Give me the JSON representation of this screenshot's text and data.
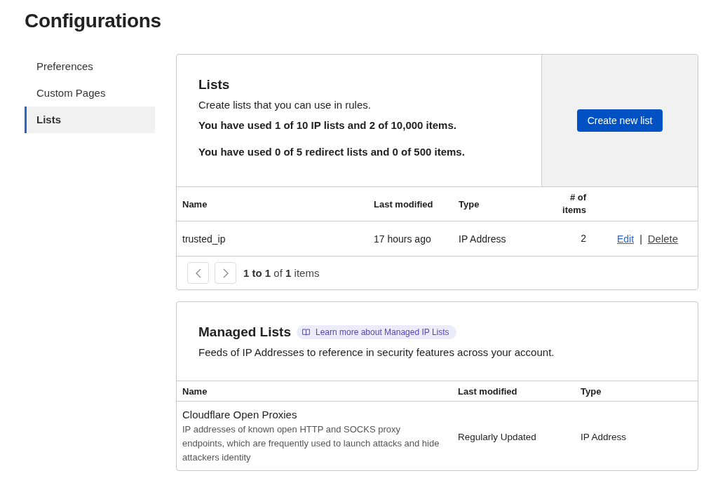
{
  "page": {
    "title": "Configurations"
  },
  "sidebar": {
    "items": [
      {
        "label": "Preferences",
        "selected": false
      },
      {
        "label": "Custom Pages",
        "selected": false
      },
      {
        "label": "Lists",
        "selected": true
      }
    ]
  },
  "lists": {
    "title": "Lists",
    "description": "Create lists that you can use in rules.",
    "usage": [
      "You have used 1 of 10 IP lists and 2 of 10,000 items.",
      "You have used 0 of 5 redirect lists and 0 of 500 items."
    ],
    "create_button": "Create new list",
    "table": {
      "columns": [
        "Name",
        "Last modified",
        "Type",
        "# of items"
      ],
      "rows": [
        {
          "name": "trusted_ip",
          "last_modified": "17 hours ago",
          "type": "IP Address",
          "items": "2",
          "separator": "|",
          "actions": [
            {
              "label": "Edit",
              "kind": "primary"
            },
            {
              "label": "Delete",
              "kind": "secondary"
            }
          ]
        }
      ]
    },
    "pagination": {
      "summary": "**1 to 1** of **1** items"
    }
  },
  "managed_lists": {
    "title": "Managed Lists",
    "learn_more": "Learn more about Managed IP Lists",
    "description": "Feeds of IP Addresses to reference in security features across your account.",
    "table": {
      "columns": [
        "Name",
        "Last modified",
        "Type"
      ],
      "rows": [
        {
          "name": "Cloudflare Open Proxies",
          "description": "IP addresses of known open HTTP and SOCKS proxy endpoints, which are frequently used to launch attacks and hide attackers identity",
          "last_modified": "Regularly Updated",
          "type": "IP Address"
        }
      ]
    }
  }
}
